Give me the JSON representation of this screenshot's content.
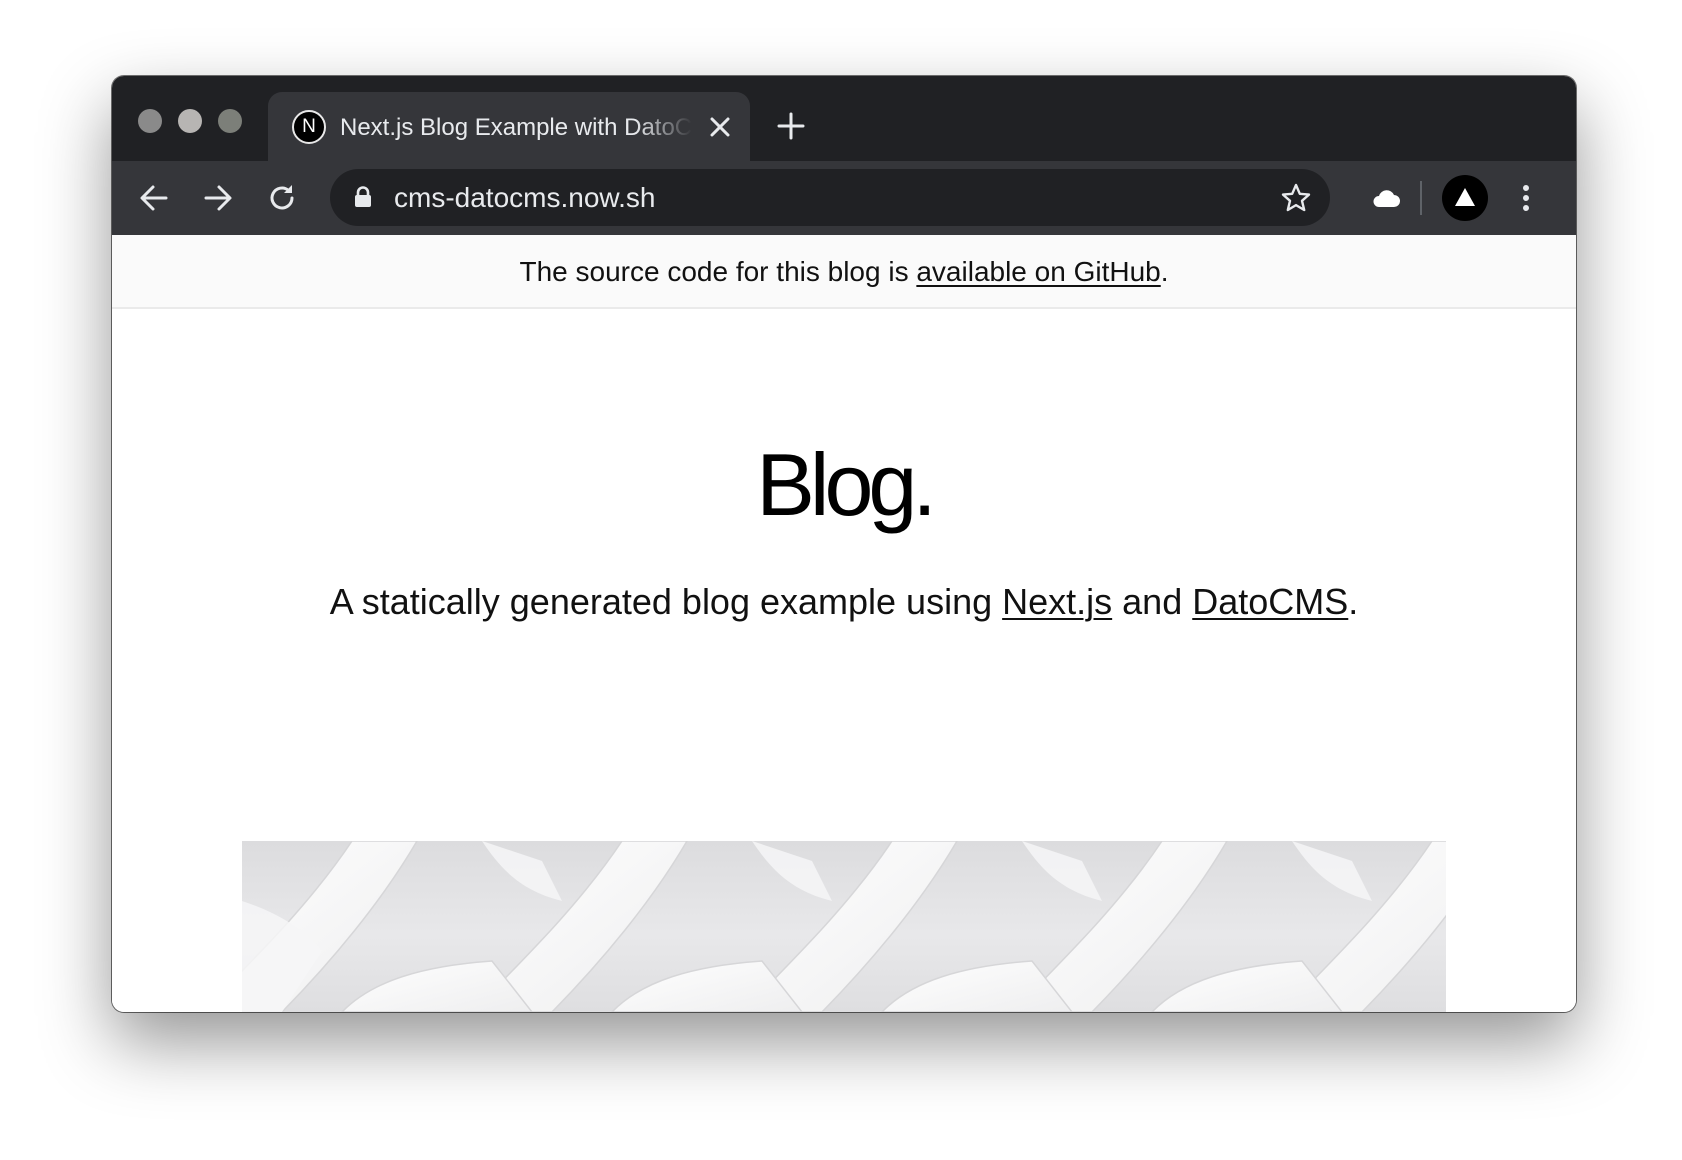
{
  "tab": {
    "favicon_letter": "N",
    "title": "Next.js Blog Example with DatoCMS"
  },
  "toolbar": {
    "url": "cms-datocms.now.sh"
  },
  "banner": {
    "text_before": "The source code for this blog is ",
    "link_text": "available on GitHub",
    "text_after": "."
  },
  "header": {
    "title": "Blog."
  },
  "intro": {
    "text_before": "A statically generated blog example using ",
    "link1": "Next.js",
    "text_middle": " and ",
    "link2": "DatoCMS",
    "text_after": "."
  },
  "icons": {
    "traffic_lights": [
      "close-dot",
      "minimize-dot",
      "maximize-dot"
    ],
    "toolbar": [
      "back-arrow-icon",
      "forward-arrow-icon",
      "reload-icon",
      "lock-icon",
      "star-icon",
      "cloud-extension-icon",
      "account-avatar-icon",
      "more-menu-icon"
    ]
  },
  "colors": {
    "tabstrip_bg": "#202124",
    "toolbar_bg": "#35363a",
    "omnibox_bg": "#202124",
    "page_bg": "#ffffff",
    "banner_bg": "#fafafa"
  }
}
